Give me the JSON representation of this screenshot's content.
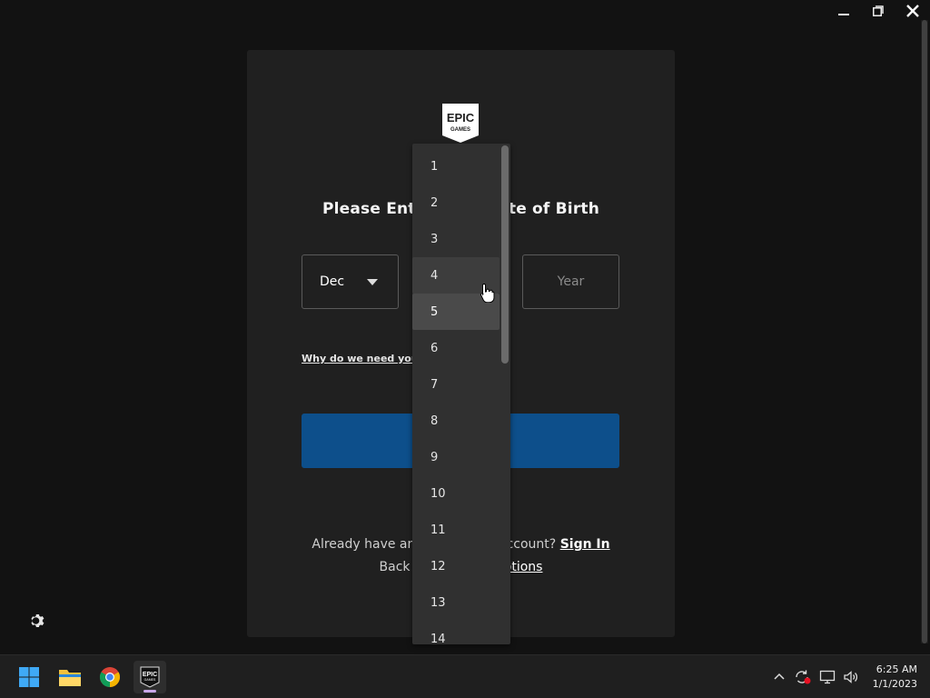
{
  "window": {
    "controls": {
      "minimize_icon": "minimize-icon",
      "restore_icon": "restore-icon",
      "close_icon": "close-icon"
    }
  },
  "card": {
    "logo": {
      "line1": "EPIC",
      "line2": "GAMES"
    },
    "title": "Please Enter Your Date of Birth",
    "month_value": "Dec",
    "year_placeholder": "Year",
    "why_link": "Why do we need your date of birth?",
    "continue_label": "",
    "signin_prefix": "Already have an Epic Games account?",
    "signin_link": "Sign In",
    "back_prefix": "Back to",
    "back_link": "all sign in options"
  },
  "day_dropdown": {
    "options": [
      "1",
      "2",
      "3",
      "4",
      "5",
      "6",
      "7",
      "8",
      "9",
      "10",
      "11",
      "12",
      "13",
      "14"
    ],
    "hovered": "4",
    "selected": "5"
  },
  "settings_icon": "gear-icon",
  "taskbar": {
    "apps": [
      {
        "name": "windows-start",
        "icon": "windows-logo-icon"
      },
      {
        "name": "file-explorer",
        "icon": "folder-icon"
      },
      {
        "name": "chrome",
        "icon": "chrome-icon"
      },
      {
        "name": "epic-games-launcher",
        "icon": "epic-games-icon",
        "label_line1": "EPIC",
        "label_line2": "GAMES"
      }
    ],
    "tray_icons": [
      "chevron-up-icon",
      "sync-icon",
      "network-icon",
      "volume-icon"
    ],
    "time": "6:25 AM",
    "date": "1/1/2023"
  },
  "colors": {
    "accent_button": "#0d4f8b",
    "card_bg": "#202020",
    "app_bg": "#121212"
  }
}
